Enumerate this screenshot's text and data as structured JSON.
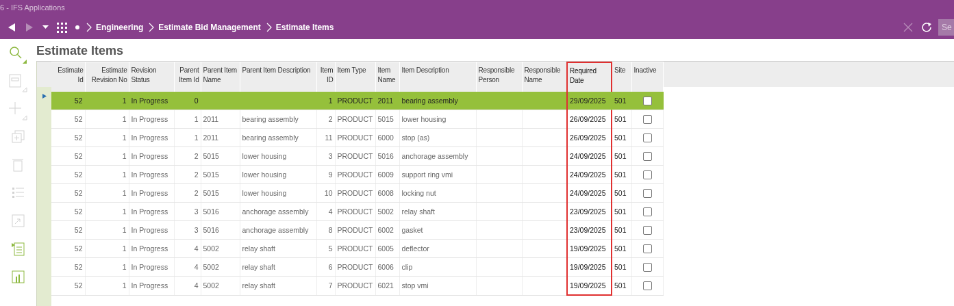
{
  "window": {
    "title": "6 - IFS Applications"
  },
  "nav": {
    "breadcrumb": [
      "Engineering",
      "Estimate Bid Management",
      "Estimate Items"
    ],
    "search": {
      "placeholder": "Se"
    }
  },
  "sidebar": {
    "tools": [
      {
        "kind": "search",
        "disabled": false
      },
      {
        "kind": "save",
        "disabled": true
      },
      {
        "kind": "new",
        "disabled": true
      },
      {
        "kind": "duplicate",
        "disabled": true
      },
      {
        "kind": "delete",
        "disabled": true
      },
      {
        "kind": "list",
        "disabled": true
      },
      {
        "kind": "open",
        "disabled": true
      },
      {
        "kind": "details",
        "disabled": false
      },
      {
        "kind": "chart",
        "disabled": false
      }
    ]
  },
  "page": {
    "title": "Estimate Items"
  },
  "table": {
    "columns": [
      {
        "label": "Estimate Id",
        "kind": "number",
        "highlighted": false
      },
      {
        "label": "Estimate Revision No",
        "kind": "number",
        "highlighted": false
      },
      {
        "label": "Revision Status",
        "kind": "text",
        "highlighted": false
      },
      {
        "label": "Parent Item Id",
        "kind": "number",
        "highlighted": false
      },
      {
        "label": "Parent Item Name",
        "kind": "text",
        "highlighted": false
      },
      {
        "label": "Parent Item Description",
        "kind": "text",
        "highlighted": false
      },
      {
        "label": "Item ID",
        "kind": "number",
        "highlighted": false
      },
      {
        "label": "Item Type",
        "kind": "text",
        "highlighted": false
      },
      {
        "label": "Item Name",
        "kind": "text",
        "highlighted": false
      },
      {
        "label": "Item Description",
        "kind": "text",
        "highlighted": false
      },
      {
        "label": "Responsible Person",
        "kind": "text",
        "highlighted": false
      },
      {
        "label": "Responsible Name",
        "kind": "text",
        "highlighted": false
      },
      {
        "label": "Required Date",
        "kind": "text",
        "highlighted": true
      },
      {
        "label": "Site",
        "kind": "text",
        "highlighted": false
      },
      {
        "label": "Inactive",
        "kind": "checkbox",
        "highlighted": false
      }
    ],
    "rows": [
      {
        "selected": true,
        "cells": [
          "52",
          "1",
          "In Progress",
          "0",
          "",
          "",
          "1",
          "PRODUCT",
          "2011",
          "bearing assembly",
          "",
          "",
          "29/09/2025",
          "501"
        ],
        "inactive": false
      },
      {
        "selected": false,
        "cells": [
          "52",
          "1",
          "In Progress",
          "1",
          "2011",
          "bearing assembly",
          "2",
          "PRODUCT",
          "5015",
          "lower housing",
          "",
          "",
          "26/09/2025",
          "501"
        ],
        "inactive": false
      },
      {
        "selected": false,
        "cells": [
          "52",
          "1",
          "In Progress",
          "1",
          "2011",
          "bearing assembly",
          "11",
          "PRODUCT",
          "6000",
          "stop (as)",
          "",
          "",
          "26/09/2025",
          "501"
        ],
        "inactive": false
      },
      {
        "selected": false,
        "cells": [
          "52",
          "1",
          "In Progress",
          "2",
          "5015",
          "lower housing",
          "3",
          "PRODUCT",
          "5016",
          "anchorage assembly",
          "",
          "",
          "24/09/2025",
          "501"
        ],
        "inactive": false
      },
      {
        "selected": false,
        "cells": [
          "52",
          "1",
          "In Progress",
          "2",
          "5015",
          "lower housing",
          "9",
          "PRODUCT",
          "6009",
          "support ring vmi",
          "",
          "",
          "24/09/2025",
          "501"
        ],
        "inactive": false
      },
      {
        "selected": false,
        "cells": [
          "52",
          "1",
          "In Progress",
          "2",
          "5015",
          "lower housing",
          "10",
          "PRODUCT",
          "6008",
          "locking nut",
          "",
          "",
          "24/09/2025",
          "501"
        ],
        "inactive": false
      },
      {
        "selected": false,
        "cells": [
          "52",
          "1",
          "In Progress",
          "3",
          "5016",
          "anchorage assembly",
          "4",
          "PRODUCT",
          "5002",
          "relay shaft",
          "",
          "",
          "23/09/2025",
          "501"
        ],
        "inactive": false
      },
      {
        "selected": false,
        "cells": [
          "52",
          "1",
          "In Progress",
          "3",
          "5016",
          "anchorage assembly",
          "8",
          "PRODUCT",
          "6002",
          "gasket",
          "",
          "",
          "23/09/2025",
          "501"
        ],
        "inactive": false
      },
      {
        "selected": false,
        "cells": [
          "52",
          "1",
          "In Progress",
          "4",
          "5002",
          "relay shaft",
          "5",
          "PRODUCT",
          "6005",
          "deflector",
          "",
          "",
          "19/09/2025",
          "501"
        ],
        "inactive": false
      },
      {
        "selected": false,
        "cells": [
          "52",
          "1",
          "In Progress",
          "4",
          "5002",
          "relay shaft",
          "6",
          "PRODUCT",
          "6006",
          "clip",
          "",
          "",
          "19/09/2025",
          "501"
        ],
        "inactive": false
      },
      {
        "selected": false,
        "cells": [
          "52",
          "1",
          "In Progress",
          "4",
          "5002",
          "relay shaft",
          "7",
          "PRODUCT",
          "6021",
          "stop vmi",
          "",
          "",
          "19/09/2025",
          "501"
        ],
        "inactive": false
      }
    ]
  }
}
